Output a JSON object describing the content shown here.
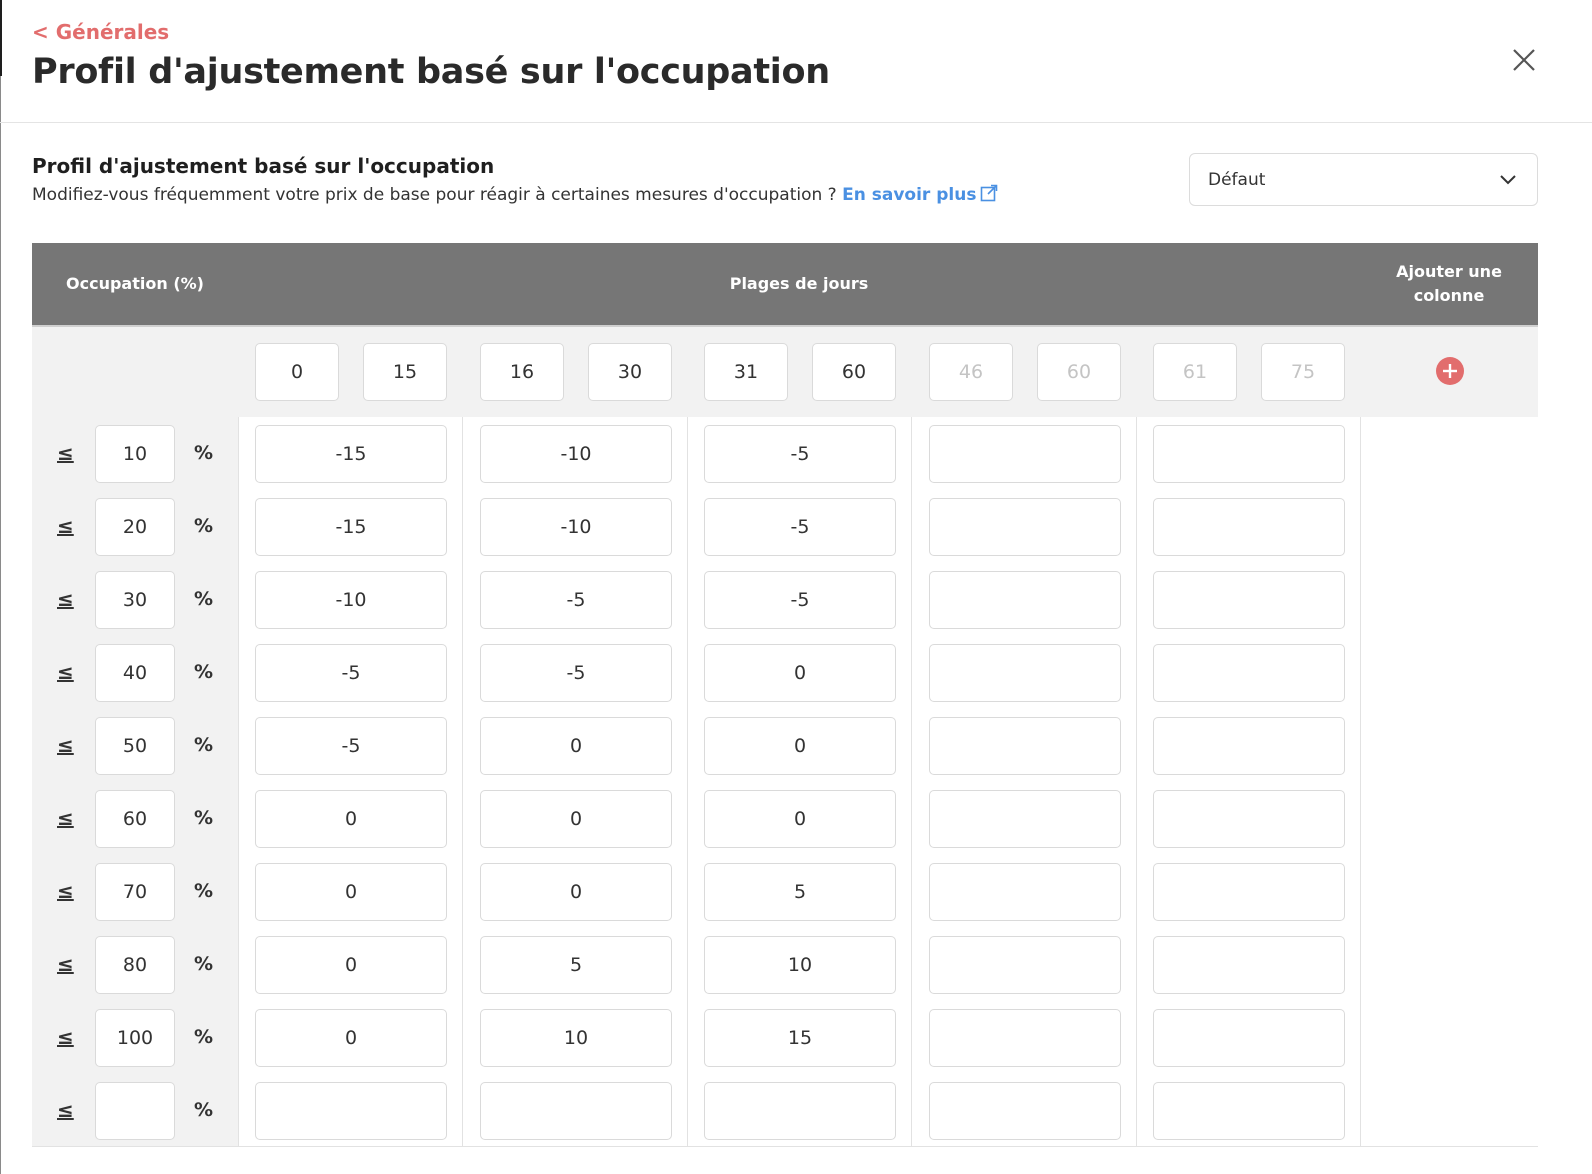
{
  "header": {
    "back_label": "< Générales",
    "title": "Profil d'ajustement basé sur l'occupation",
    "close_icon": "close-icon"
  },
  "section": {
    "title": "Profil d'ajustement basé sur l'occupation",
    "description": "Modifiez-vous fréquemment votre prix de base pour réagir à certaines mesures d'occupation ?",
    "learn_more": "En savoir plus",
    "link_icon": "external-link-icon"
  },
  "profile_select": {
    "value": "Défaut",
    "icon": "chevron-down-icon"
  },
  "table": {
    "headers": {
      "occupation": "Occupation (%)",
      "day_ranges": "Plages de jours",
      "add_column": "Ajouter une colonne"
    },
    "le_symbol": "≤",
    "percent_symbol": "%",
    "day_ranges": [
      {
        "from": "0",
        "to": "15",
        "active": true
      },
      {
        "from": "16",
        "to": "30",
        "active": true
      },
      {
        "from": "31",
        "to": "60",
        "active": true
      },
      {
        "from": "46",
        "to": "60",
        "active": false
      },
      {
        "from": "61",
        "to": "75",
        "active": false
      }
    ],
    "rows": [
      {
        "occupation": "10",
        "values": [
          "-15",
          "-10",
          "-5",
          "",
          ""
        ]
      },
      {
        "occupation": "20",
        "values": [
          "-15",
          "-10",
          "-5",
          "",
          ""
        ]
      },
      {
        "occupation": "30",
        "values": [
          "-10",
          "-5",
          "-5",
          "",
          ""
        ]
      },
      {
        "occupation": "40",
        "values": [
          "-5",
          "-5",
          "0",
          "",
          ""
        ]
      },
      {
        "occupation": "50",
        "values": [
          "-5",
          "0",
          "0",
          "",
          ""
        ]
      },
      {
        "occupation": "60",
        "values": [
          "0",
          "0",
          "0",
          "",
          ""
        ]
      },
      {
        "occupation": "70",
        "values": [
          "0",
          "0",
          "5",
          "",
          ""
        ]
      },
      {
        "occupation": "80",
        "values": [
          "0",
          "5",
          "10",
          "",
          ""
        ]
      },
      {
        "occupation": "100",
        "values": [
          "0",
          "10",
          "15",
          "",
          ""
        ]
      },
      {
        "occupation": "",
        "values": [
          "",
          "",
          "",
          "",
          ""
        ]
      }
    ],
    "add_icon": "plus-circle-icon"
  },
  "colors": {
    "accent": "#e26d6d",
    "link": "#4a90e2",
    "header_bg": "#767676"
  }
}
